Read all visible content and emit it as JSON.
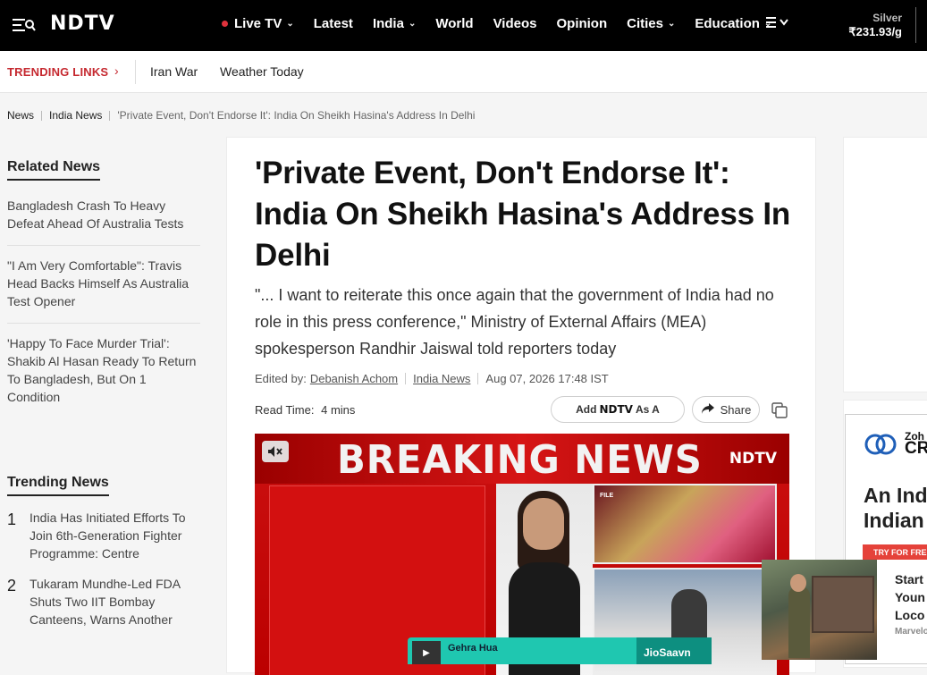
{
  "header": {
    "logo": "NDTV",
    "nav": [
      {
        "label": "Live TV",
        "live": true,
        "has_chevron": true
      },
      {
        "label": "Latest",
        "live": false,
        "has_chevron": false
      },
      {
        "label": "India",
        "live": false,
        "has_chevron": true
      },
      {
        "label": "World",
        "live": false,
        "has_chevron": false
      },
      {
        "label": "Videos",
        "live": false,
        "has_chevron": false
      },
      {
        "label": "Opinion",
        "live": false,
        "has_chevron": false
      },
      {
        "label": "Cities",
        "live": false,
        "has_chevron": true
      },
      {
        "label": "Education",
        "live": false,
        "has_chevron": true
      }
    ],
    "metal_label": "Silver",
    "metal_price": "₹231.93/g"
  },
  "trending_links": {
    "label": "TRENDING LINKS",
    "links": [
      "Iran War",
      "Weather Today"
    ]
  },
  "breadcrumb": {
    "items": [
      "News",
      "India News"
    ],
    "current": "'Private Event, Don't Endorse It': India On Sheikh Hasina's Address In Delhi"
  },
  "related": {
    "title": "Related News",
    "items": [
      "Bangladesh Crash To Heavy Defeat Ahead Of Australia Tests",
      "\"I Am Very Comfortable\": Travis Head Backs Himself As Australia Test Opener",
      "'Happy To Face Murder Trial': Shakib Al Hasan Ready To Return To Bangladesh, But On 1 Condition"
    ]
  },
  "trending": {
    "title": "Trending News",
    "items": [
      {
        "num": "1",
        "text": "India Has Initiated Efforts To Join 6th-Generation Fighter Programme: Centre"
      },
      {
        "num": "2",
        "text": "Tukaram Mundhe-Led FDA Shuts Two IIT Bombay Canteens, Warns Another"
      }
    ]
  },
  "article": {
    "headline": "'Private Event, Don't Endorse It': India On Sheikh Hasina's Address In Delhi",
    "subhead": "\"... I want to reiterate this once again that the government of India had no role in this press conference,\" Ministry of External Affairs (MEA) spokesperson Randhir Jaiswal told reporters today",
    "edited_by_label": "Edited by:",
    "editor": "Debanish Achom",
    "category": "India News",
    "date": "Aug 07, 2026 17:48 IST",
    "read_time_label": "Read Time:",
    "read_time": "4 mins",
    "add_label_pre": "Add",
    "add_label_logo": "NDTV",
    "add_label_post": "As A",
    "share_label": "Share"
  },
  "video": {
    "banner": "BREAKING NEWS",
    "logo": "NDTV",
    "file_tag": "FILE"
  },
  "ad": {
    "brand_small": "Zoh",
    "brand_big": "CR",
    "headline_1": "An Ind",
    "headline_2": "Indian",
    "cta": "TRY FOR FREE"
  },
  "promo": {
    "line1": "Start",
    "line2": "Youn",
    "line3": "Loco",
    "source": "Marvelo"
  },
  "music": {
    "song": "Gehra Hua",
    "service": "JioSaavn"
  },
  "colors": {
    "accent_red": "#c5282f",
    "live_dot": "#e0323c",
    "music_teal": "#1fc7b0"
  }
}
